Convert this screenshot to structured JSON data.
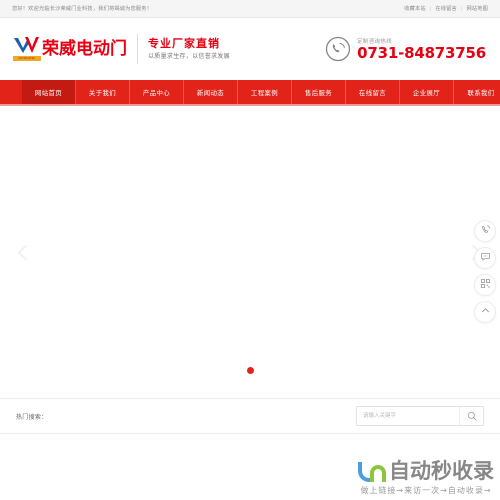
{
  "topbar": {
    "welcome": "您好！欢迎光临长沙荣威门业科技，我们将竭诚为您服务！",
    "links": [
      {
        "label": "收藏本站"
      },
      {
        "label": "在线留言"
      },
      {
        "label": "网站地图"
      }
    ],
    "separator": "|"
  },
  "header": {
    "logo_text": "荣威电动门",
    "logo_sub": "RONGWEI",
    "slogan_main": "专业厂家直销",
    "slogan_sub": "以质量求生存，以信誉求发展",
    "phone_label": "定制咨询热线",
    "phone_number": "0731-84873756"
  },
  "nav": {
    "items": [
      {
        "label": "网站首页",
        "active": true
      },
      {
        "label": "关于我们",
        "active": false
      },
      {
        "label": "产品中心",
        "active": false
      },
      {
        "label": "新闻动态",
        "active": false
      },
      {
        "label": "工程案例",
        "active": false
      },
      {
        "label": "售后服务",
        "active": false
      },
      {
        "label": "在线留言",
        "active": false
      },
      {
        "label": "企业展厅",
        "active": false
      },
      {
        "label": "联系我们",
        "active": false
      }
    ]
  },
  "banner": {
    "prev_label": "上一张",
    "next_label": "下一张",
    "slide_count": 1,
    "active_slide": 1
  },
  "search": {
    "hot_label": "热门搜索：",
    "hot_terms": [],
    "placeholder": "请输入关键字",
    "value": "",
    "button_label": "搜索"
  },
  "side_tools": [
    {
      "name": "phone-tool",
      "label": "电话咨询"
    },
    {
      "name": "message-tool",
      "label": "在线留言"
    },
    {
      "name": "qrcode-tool",
      "label": "二维码"
    },
    {
      "name": "backtotop-tool",
      "label": "返回顶部"
    }
  ],
  "watermark": {
    "text": "自动秒收录",
    "subtitle": "做上链接→来访一次→自动收录→"
  },
  "colors": {
    "brand_red": "#e2231a",
    "nav_active": "#c31b12",
    "logo_blue": "#1a5fb4",
    "logo_orange": "#f5a623",
    "watermark_blue": "#4a9fe0",
    "watermark_green": "#8cc63f"
  }
}
